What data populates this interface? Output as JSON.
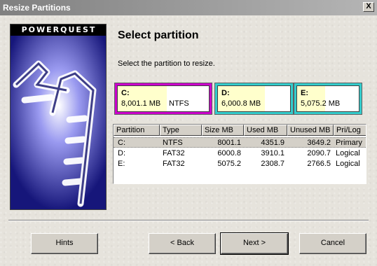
{
  "window": {
    "title": "Resize Partitions",
    "close_glyph": "X"
  },
  "banner": {
    "brand": "POWERQUEST"
  },
  "heading": "Select partition",
  "instruction": "Select the partition to resize.",
  "cards": [
    {
      "letter": "C:",
      "size": "8,001.1 MB",
      "fs": "NTFS",
      "border_color": "#cc00cc",
      "used_fraction": 0.54
    },
    {
      "letter": "D:",
      "size": "6,000.8 MB",
      "fs": "",
      "border_color": "#33cccc",
      "used_fraction": 0.65
    },
    {
      "letter": "E:",
      "size": "5,075.2 MB",
      "fs": "",
      "border_color": "#33cccc",
      "used_fraction": 0.45
    }
  ],
  "table": {
    "headers": [
      "Partition",
      "Type",
      "Size MB",
      "Used MB",
      "Unused MB",
      "Pri/Log"
    ],
    "rows": [
      [
        "C:",
        "NTFS",
        "8001.1",
        "4351.9",
        "3649.2",
        "Primary"
      ],
      [
        "D:",
        "FAT32",
        "6000.8",
        "3910.1",
        "2090.7",
        "Logical"
      ],
      [
        "E:",
        "FAT32",
        "5075.2",
        "2308.7",
        "2766.5",
        "Logical"
      ]
    ]
  },
  "buttons": {
    "hints": "Hints",
    "back": "< Back",
    "next": "Next >",
    "cancel": "Cancel"
  }
}
